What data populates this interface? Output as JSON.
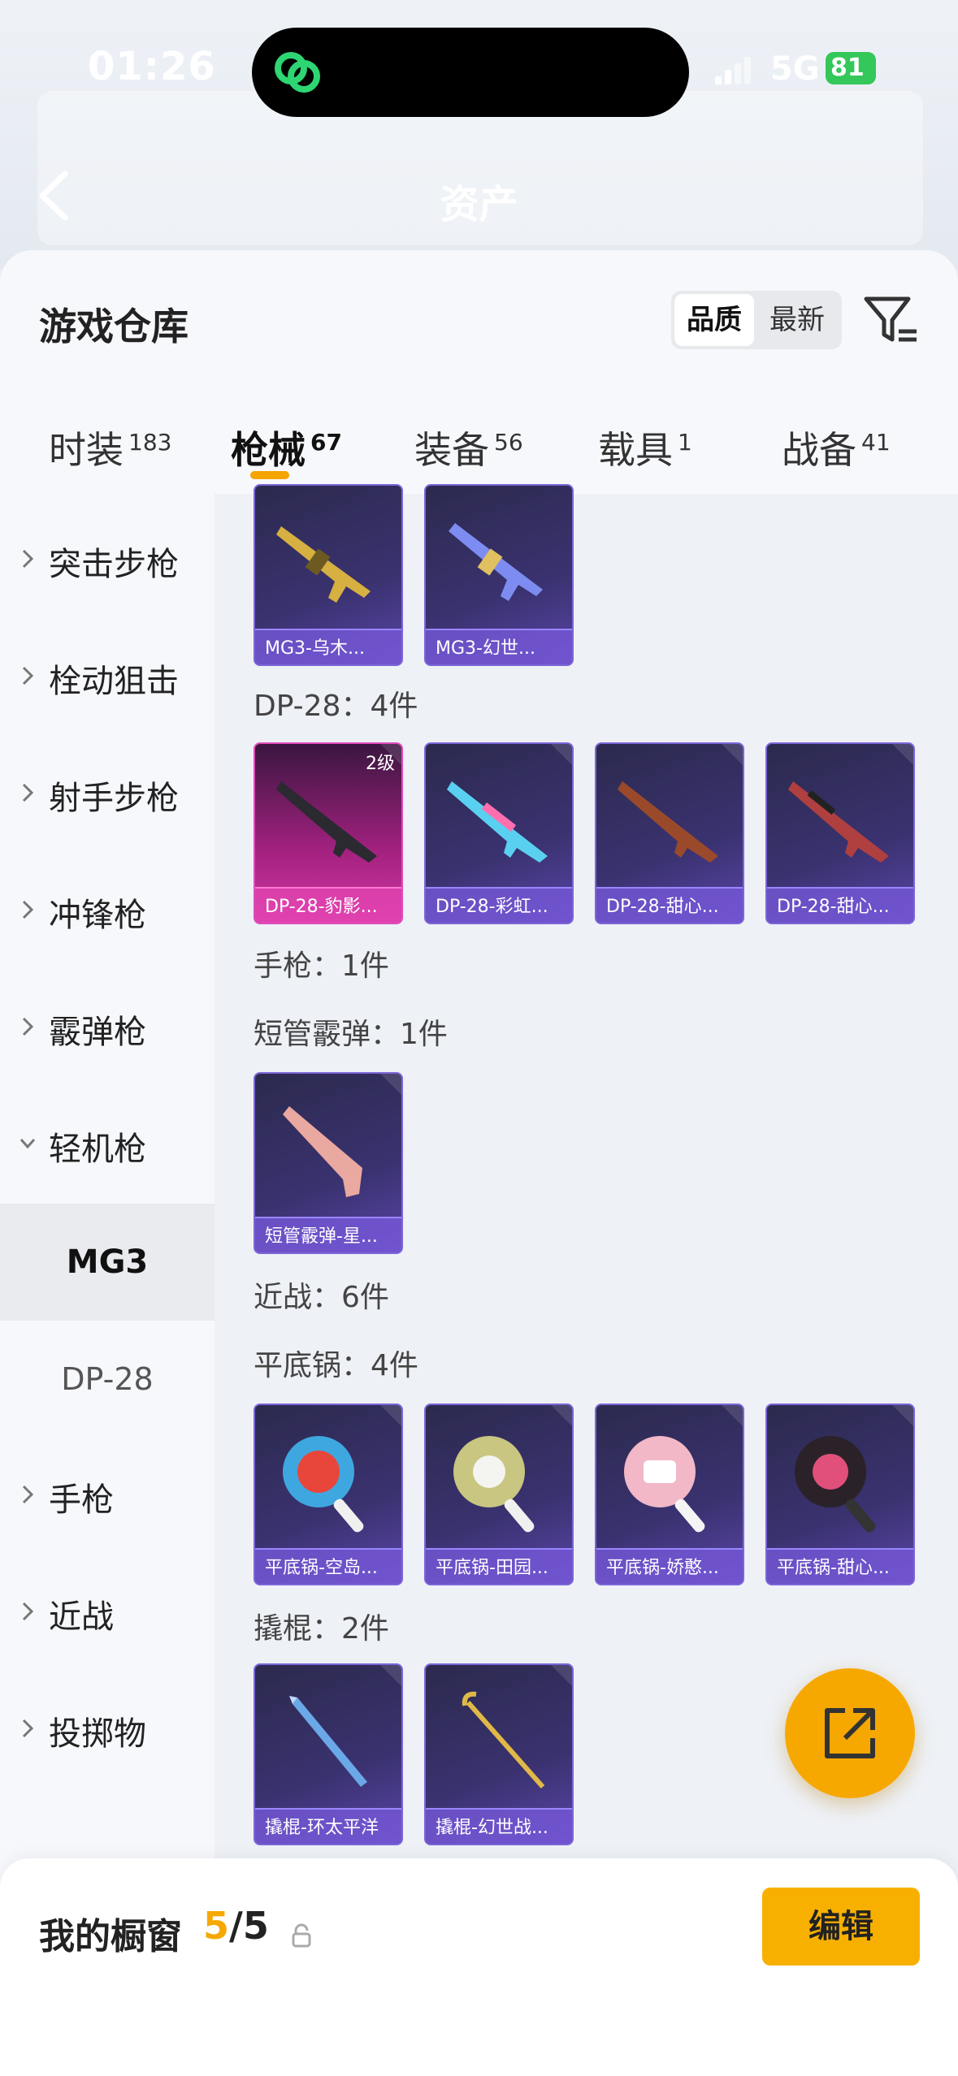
{
  "status_bar": {
    "time": "01:26",
    "network": "5G",
    "battery": "81"
  },
  "header": {
    "title": "资产"
  },
  "warehouse": {
    "title": "游戏仓库",
    "sort": [
      "品质",
      "最新"
    ],
    "tabs": [
      {
        "label": "时装",
        "count": "183"
      },
      {
        "label": "枪械",
        "count": "67"
      },
      {
        "label": "装备",
        "count": "56"
      },
      {
        "label": "载具",
        "count": "1"
      },
      {
        "label": "战备",
        "count": "41"
      }
    ]
  },
  "sidebar": {
    "items": [
      "突击步枪",
      "栓动狙击",
      "射手步枪",
      "冲锋枪",
      "霰弹枪",
      "轻机枪",
      "手枪",
      "近战",
      "投掷物"
    ],
    "sub_items": [
      "MG3",
      "DP-28"
    ]
  },
  "content": {
    "mg3_items": [
      "MG3-乌木...",
      "MG3-幻世..."
    ],
    "dp28_label": "DP-28：4件",
    "dp28_items": [
      "DP-28-豹影...",
      "DP-28-彩虹...",
      "DP-28-甜心...",
      "DP-28-甜心..."
    ],
    "dp28_level": "2级",
    "pistol_label": "手枪：1件",
    "sawed_label": "短管霰弹：1件",
    "sawed_items": [
      "短管霰弹-星..."
    ],
    "melee_label": "近战：6件",
    "pan_label": "平底锅：4件",
    "pan_items": [
      "平底锅-空岛...",
      "平底锅-田园...",
      "平底锅-娇憨...",
      "平底锅-甜心..."
    ],
    "crowbar_label": "撬棍：2件",
    "crowbar_items": [
      "撬棍-环太平洋",
      "撬棍-幻世战..."
    ]
  },
  "bottom": {
    "title": "我的橱窗",
    "count_current": "5",
    "count_total": "/5",
    "edit_label": "编辑"
  },
  "colors": {
    "accent": "#f6a800",
    "card_purple": "#3a3270",
    "card_pink": "#a3217f"
  }
}
